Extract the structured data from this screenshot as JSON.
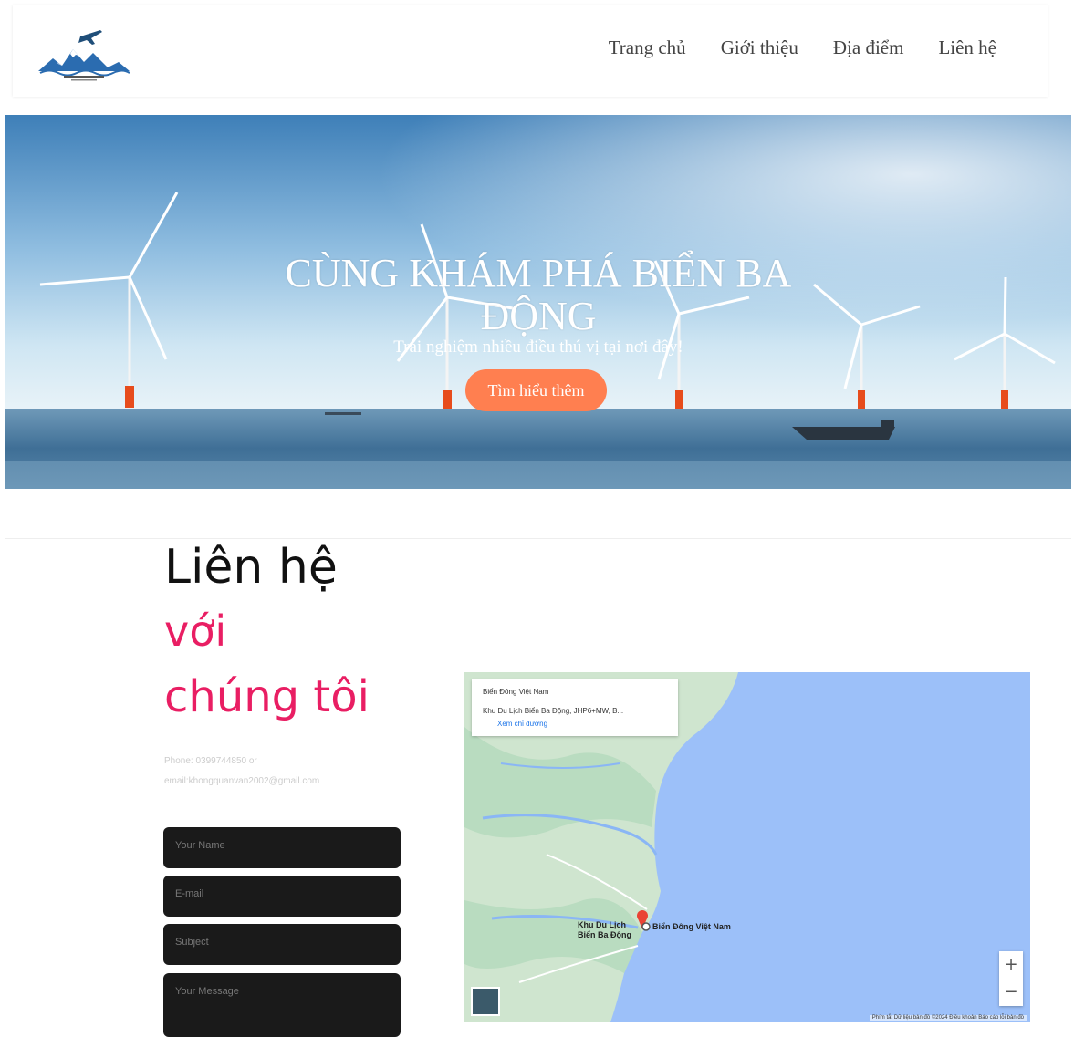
{
  "nav": {
    "links": [
      "Trang chủ",
      "Giới thiệu",
      "Địa điểm",
      "Liên hệ"
    ]
  },
  "hero": {
    "title_line1": "CÙNG KHÁM PHÁ BIỂN BA",
    "title_line2": "ĐỘNG",
    "subtitle": "Trải nghiệm nhiều điều thú vị tại nơi đây!",
    "button": "Tìm hiểu thêm"
  },
  "contact": {
    "heading": "Liên hệ",
    "pink1": "với",
    "pink2": "chúng tôi",
    "phone": "Phone: 0399744850 or",
    "email": "email:khongquanvan2002@gmail.com",
    "form": {
      "name": "Your Name",
      "email": "E-mail",
      "subject": "Subject",
      "message": "Your Message"
    }
  },
  "map": {
    "card_row1": "Biển Đông Việt Nam",
    "card_row2": "Khu Du Lịch Biển Ba Động, JHP6+MW, B...",
    "card_row3": "Xem chỉ đường",
    "label_main": "Khu Du Lịch Biển Ba Động",
    "label_right": "Biển Đông Việt Nam",
    "zoom_in": "+",
    "zoom_out": "−",
    "footer": "Phím tắt   Dữ liệu bản đồ ©2024   Điều khoản   Báo cáo lỗi bản đồ"
  },
  "colors": {
    "accent_pink": "#e91e63",
    "button_orange": "#ff7f50",
    "form_bg": "#1a1a1a"
  }
}
